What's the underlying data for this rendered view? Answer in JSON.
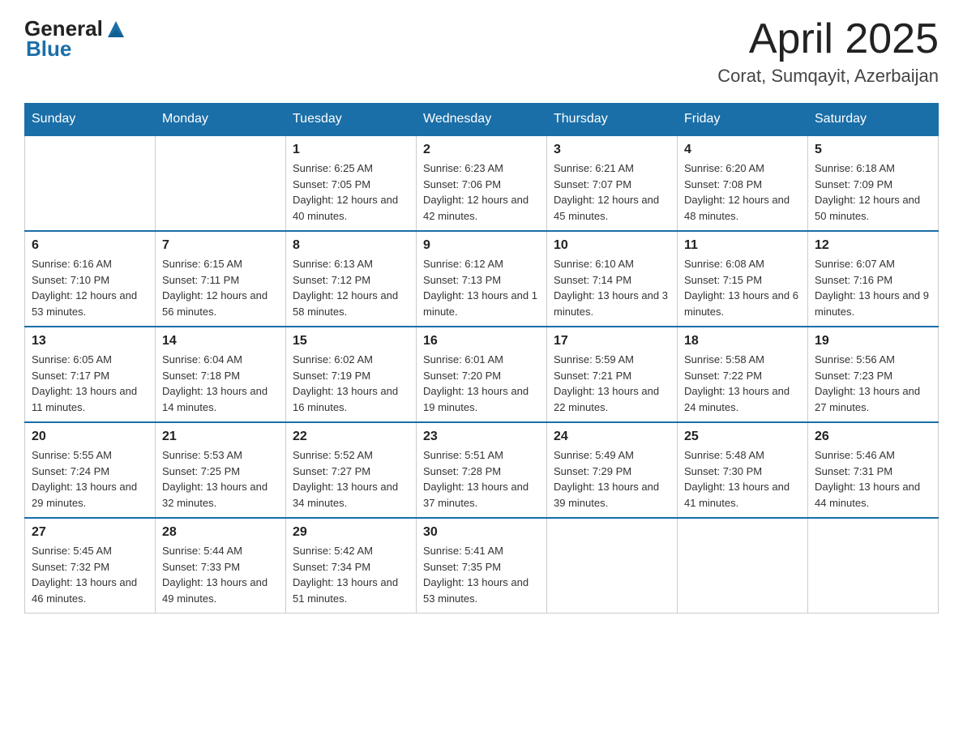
{
  "header": {
    "logo_general": "General",
    "logo_blue": "Blue",
    "title": "April 2025",
    "subtitle": "Corat, Sumqayit, Azerbaijan"
  },
  "days_of_week": [
    "Sunday",
    "Monday",
    "Tuesday",
    "Wednesday",
    "Thursday",
    "Friday",
    "Saturday"
  ],
  "weeks": [
    [
      {
        "day": "",
        "sunrise": "",
        "sunset": "",
        "daylight": ""
      },
      {
        "day": "",
        "sunrise": "",
        "sunset": "",
        "daylight": ""
      },
      {
        "day": "1",
        "sunrise": "Sunrise: 6:25 AM",
        "sunset": "Sunset: 7:05 PM",
        "daylight": "Daylight: 12 hours and 40 minutes."
      },
      {
        "day": "2",
        "sunrise": "Sunrise: 6:23 AM",
        "sunset": "Sunset: 7:06 PM",
        "daylight": "Daylight: 12 hours and 42 minutes."
      },
      {
        "day": "3",
        "sunrise": "Sunrise: 6:21 AM",
        "sunset": "Sunset: 7:07 PM",
        "daylight": "Daylight: 12 hours and 45 minutes."
      },
      {
        "day": "4",
        "sunrise": "Sunrise: 6:20 AM",
        "sunset": "Sunset: 7:08 PM",
        "daylight": "Daylight: 12 hours and 48 minutes."
      },
      {
        "day": "5",
        "sunrise": "Sunrise: 6:18 AM",
        "sunset": "Sunset: 7:09 PM",
        "daylight": "Daylight: 12 hours and 50 minutes."
      }
    ],
    [
      {
        "day": "6",
        "sunrise": "Sunrise: 6:16 AM",
        "sunset": "Sunset: 7:10 PM",
        "daylight": "Daylight: 12 hours and 53 minutes."
      },
      {
        "day": "7",
        "sunrise": "Sunrise: 6:15 AM",
        "sunset": "Sunset: 7:11 PM",
        "daylight": "Daylight: 12 hours and 56 minutes."
      },
      {
        "day": "8",
        "sunrise": "Sunrise: 6:13 AM",
        "sunset": "Sunset: 7:12 PM",
        "daylight": "Daylight: 12 hours and 58 minutes."
      },
      {
        "day": "9",
        "sunrise": "Sunrise: 6:12 AM",
        "sunset": "Sunset: 7:13 PM",
        "daylight": "Daylight: 13 hours and 1 minute."
      },
      {
        "day": "10",
        "sunrise": "Sunrise: 6:10 AM",
        "sunset": "Sunset: 7:14 PM",
        "daylight": "Daylight: 13 hours and 3 minutes."
      },
      {
        "day": "11",
        "sunrise": "Sunrise: 6:08 AM",
        "sunset": "Sunset: 7:15 PM",
        "daylight": "Daylight: 13 hours and 6 minutes."
      },
      {
        "day": "12",
        "sunrise": "Sunrise: 6:07 AM",
        "sunset": "Sunset: 7:16 PM",
        "daylight": "Daylight: 13 hours and 9 minutes."
      }
    ],
    [
      {
        "day": "13",
        "sunrise": "Sunrise: 6:05 AM",
        "sunset": "Sunset: 7:17 PM",
        "daylight": "Daylight: 13 hours and 11 minutes."
      },
      {
        "day": "14",
        "sunrise": "Sunrise: 6:04 AM",
        "sunset": "Sunset: 7:18 PM",
        "daylight": "Daylight: 13 hours and 14 minutes."
      },
      {
        "day": "15",
        "sunrise": "Sunrise: 6:02 AM",
        "sunset": "Sunset: 7:19 PM",
        "daylight": "Daylight: 13 hours and 16 minutes."
      },
      {
        "day": "16",
        "sunrise": "Sunrise: 6:01 AM",
        "sunset": "Sunset: 7:20 PM",
        "daylight": "Daylight: 13 hours and 19 minutes."
      },
      {
        "day": "17",
        "sunrise": "Sunrise: 5:59 AM",
        "sunset": "Sunset: 7:21 PM",
        "daylight": "Daylight: 13 hours and 22 minutes."
      },
      {
        "day": "18",
        "sunrise": "Sunrise: 5:58 AM",
        "sunset": "Sunset: 7:22 PM",
        "daylight": "Daylight: 13 hours and 24 minutes."
      },
      {
        "day": "19",
        "sunrise": "Sunrise: 5:56 AM",
        "sunset": "Sunset: 7:23 PM",
        "daylight": "Daylight: 13 hours and 27 minutes."
      }
    ],
    [
      {
        "day": "20",
        "sunrise": "Sunrise: 5:55 AM",
        "sunset": "Sunset: 7:24 PM",
        "daylight": "Daylight: 13 hours and 29 minutes."
      },
      {
        "day": "21",
        "sunrise": "Sunrise: 5:53 AM",
        "sunset": "Sunset: 7:25 PM",
        "daylight": "Daylight: 13 hours and 32 minutes."
      },
      {
        "day": "22",
        "sunrise": "Sunrise: 5:52 AM",
        "sunset": "Sunset: 7:27 PM",
        "daylight": "Daylight: 13 hours and 34 minutes."
      },
      {
        "day": "23",
        "sunrise": "Sunrise: 5:51 AM",
        "sunset": "Sunset: 7:28 PM",
        "daylight": "Daylight: 13 hours and 37 minutes."
      },
      {
        "day": "24",
        "sunrise": "Sunrise: 5:49 AM",
        "sunset": "Sunset: 7:29 PM",
        "daylight": "Daylight: 13 hours and 39 minutes."
      },
      {
        "day": "25",
        "sunrise": "Sunrise: 5:48 AM",
        "sunset": "Sunset: 7:30 PM",
        "daylight": "Daylight: 13 hours and 41 minutes."
      },
      {
        "day": "26",
        "sunrise": "Sunrise: 5:46 AM",
        "sunset": "Sunset: 7:31 PM",
        "daylight": "Daylight: 13 hours and 44 minutes."
      }
    ],
    [
      {
        "day": "27",
        "sunrise": "Sunrise: 5:45 AM",
        "sunset": "Sunset: 7:32 PM",
        "daylight": "Daylight: 13 hours and 46 minutes."
      },
      {
        "day": "28",
        "sunrise": "Sunrise: 5:44 AM",
        "sunset": "Sunset: 7:33 PM",
        "daylight": "Daylight: 13 hours and 49 minutes."
      },
      {
        "day": "29",
        "sunrise": "Sunrise: 5:42 AM",
        "sunset": "Sunset: 7:34 PM",
        "daylight": "Daylight: 13 hours and 51 minutes."
      },
      {
        "day": "30",
        "sunrise": "Sunrise: 5:41 AM",
        "sunset": "Sunset: 7:35 PM",
        "daylight": "Daylight: 13 hours and 53 minutes."
      },
      {
        "day": "",
        "sunrise": "",
        "sunset": "",
        "daylight": ""
      },
      {
        "day": "",
        "sunrise": "",
        "sunset": "",
        "daylight": ""
      },
      {
        "day": "",
        "sunrise": "",
        "sunset": "",
        "daylight": ""
      }
    ]
  ]
}
